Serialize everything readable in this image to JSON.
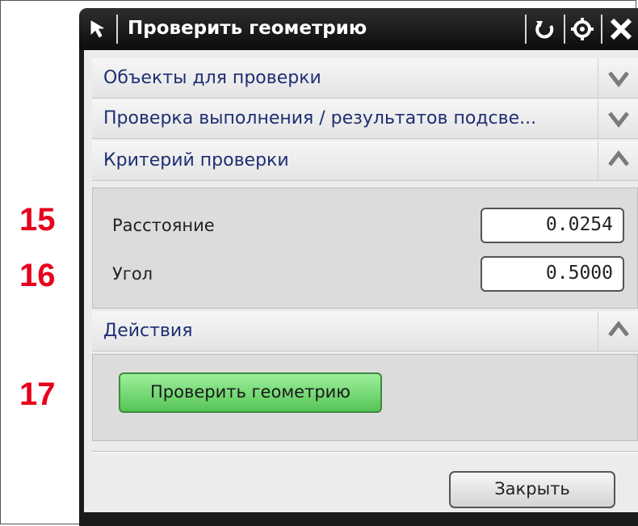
{
  "dialog": {
    "title": "Проверить геометрию",
    "icons": {
      "select": "select-arrow-icon",
      "reset": "reset-icon",
      "settings": "gear-icon",
      "close": "close-icon"
    }
  },
  "sections": [
    {
      "label": "Объекты для проверки",
      "state": "collapsed",
      "chevron": "chevron-down-icon"
    },
    {
      "label": "Проверка выполнения / результатов подсве...",
      "state": "collapsed",
      "chevron": "chevron-down-icon"
    },
    {
      "label": "Критерий проверки",
      "state": "expanded",
      "chevron": "chevron-up-icon"
    },
    {
      "label": "Действия",
      "state": "expanded",
      "chevron": "chevron-up-icon"
    }
  ],
  "criteria": {
    "distance_label": "Расстояние",
    "distance_value": "0.0254",
    "angle_label": "Угол",
    "angle_value": "0.5000"
  },
  "actions": {
    "check_button": "Проверить геометрию"
  },
  "footer": {
    "close_button": "Закрыть"
  },
  "callouts": [
    "15",
    "16",
    "17"
  ],
  "colors": {
    "callout": "#e8001c",
    "action_button": "#56c456",
    "section_label": "#1e2f74",
    "titlebar": "#0c0c0c"
  }
}
